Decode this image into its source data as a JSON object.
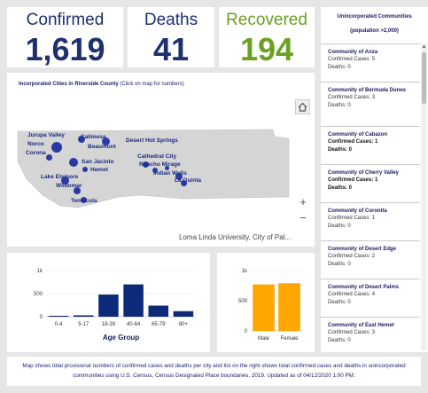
{
  "stats": {
    "confirmed": {
      "label": "Confirmed",
      "value": "1,619"
    },
    "deaths": {
      "label": "Deaths",
      "value": "41"
    },
    "recovered": {
      "label": "Recovered",
      "value": "194"
    }
  },
  "colors": {
    "navy": "#1e3070",
    "green": "#6aa121",
    "orange": "#ffa600"
  },
  "map": {
    "title": "Incorporated Cities in Riverside County",
    "hint": "(Click on map for numbers)",
    "attribution": "Loma Linda University, City of Pal...",
    "home_icon": "home-icon",
    "zoom_in": "+",
    "zoom_out": "−",
    "cities": [
      "Jurupa Valley",
      "Norco",
      "Corona",
      "Calimesa",
      "Beaumont",
      "Desert Hot Springs",
      "San Jacinto",
      "Hemet",
      "Lake Elsinore",
      "Wildomar",
      "Temecula",
      "Cathedral City",
      "Rancho Mirage",
      "Indian Wells",
      "La Quinta"
    ]
  },
  "sidebar": {
    "header": "Unincorporated Communities",
    "subheader": "(population >2,000)",
    "confirmed_prefix": "Confirmed Cases: ",
    "deaths_prefix": "Deaths: ",
    "items": [
      {
        "name": "Community of Anza",
        "confirmed": "5",
        "deaths": "0"
      },
      {
        "name": "Community of Bermuda Dunes",
        "confirmed": "3",
        "deaths": "0"
      },
      {
        "name": "Community of Cabazon",
        "confirmed": "1",
        "deaths": "0"
      },
      {
        "name": "Community of Cherry Valley",
        "confirmed": "1",
        "deaths": "0"
      },
      {
        "name": "Community of Coronita",
        "confirmed": "1",
        "deaths": "0"
      },
      {
        "name": "Community of Desert Edge",
        "confirmed": "2",
        "deaths": "0"
      },
      {
        "name": "Community of Desert Palms",
        "confirmed": "4",
        "deaths": "0"
      },
      {
        "name": "Community of East Hemet",
        "confirmed": "3",
        "deaths": "0"
      }
    ]
  },
  "chart_data": [
    {
      "type": "bar",
      "categories": [
        "0-4",
        "5-17",
        "18-39",
        "40-64",
        "65-79",
        "80+"
      ],
      "values": [
        20,
        30,
        480,
        700,
        240,
        120
      ],
      "xlabel": "Age Group",
      "ylabel": "",
      "yticks": [
        "0",
        "500",
        "1k"
      ],
      "ylim": [
        0,
        1000
      ],
      "color": "#0d2a78"
    },
    {
      "type": "bar",
      "categories": [
        "Male",
        "Female"
      ],
      "values": [
        770,
        790
      ],
      "xlabel": "",
      "ylabel": "",
      "yticks": [
        "0",
        "500",
        "1k"
      ],
      "ylim": [
        0,
        1000
      ],
      "color": "#ffa600"
    }
  ],
  "footer": {
    "text": "Map shows total provisional numbers of confirmed cases and deaths per city and list on the right shows total confirmed cases and deaths in unincorporated communities using U.S. Census, Census Designated Place boundaries, 2019. Updated as of 04/12/2020 1:00 PM."
  }
}
